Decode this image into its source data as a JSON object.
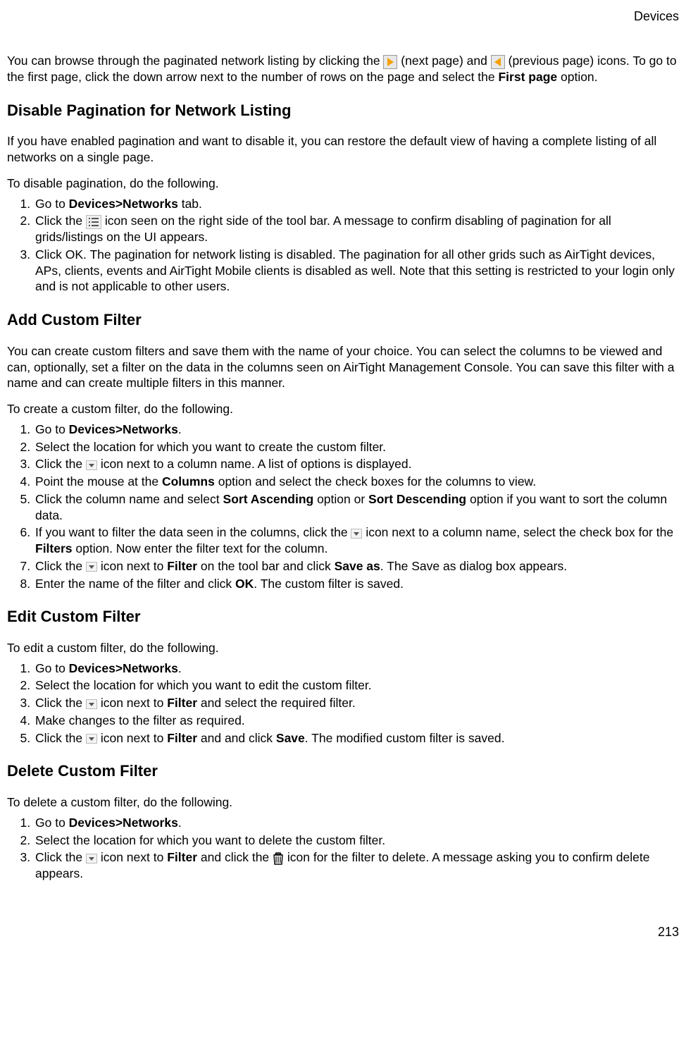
{
  "header": {
    "section": "Devices"
  },
  "footer": {
    "page": "213"
  },
  "intro": {
    "t1": "You can browse through the paginated network listing by clicking the ",
    "t2": " (next page) and ",
    "t3": " (previous page) icons. To go to the first page, click the down arrow next to the number of rows on the page and select the ",
    "t3b": "First page",
    "t4": " option."
  },
  "s1": {
    "heading": "Disable Pagination for Network Listing",
    "p1": "If you have enabled pagination and want to disable it, you can restore the default view of having a complete listing of all networks on a single page.",
    "p2": "To disable pagination, do the following.",
    "li1a": "Go to ",
    "li1b": "Devices>Networks",
    "li1c": " tab.",
    "li2a": "Click the ",
    "li2b": " icon seen on the right side of the tool bar. A message to confirm disabling of pagination for all grids/listings on the UI appears.",
    "li3": "Click OK. The pagination for network listing is disabled. The pagination for all other grids such as AirTight devices, APs, clients, events and AirTight Mobile clients is disabled as well. Note that this setting is restricted to your login only and is not applicable to other users."
  },
  "s2": {
    "heading": "Add Custom Filter",
    "p1": "You can create custom filters and save them with the name of your choice. You can select the columns to be viewed and can, optionally, set a filter on the data in the columns seen on AirTight Management Console. You can save this filter with a name and can create multiple filters in this manner.",
    "p2": "To create a custom filter, do the following.",
    "li1a": "Go to ",
    "li1b": "Devices>Networks",
    "li1c": ".",
    "li2": "Select the location for which you want to create the custom filter.",
    "li3a": "Click the ",
    "li3b": " icon next to a column name. A list of options is displayed.",
    "li4a": "Point the mouse at the ",
    "li4b": "Columns",
    "li4c": " option and select the check boxes for the columns to view.",
    "li5a": "Click the column name and select ",
    "li5b": "Sort Ascending",
    "li5c": " option or ",
    "li5d": "Sort Descending",
    "li5e": " option if you want to sort the column data.",
    "li6a": "If you want to filter the data seen in the columns, click the ",
    "li6b": "  icon next to a column name, select the check box for the ",
    "li6c": "Filters",
    "li6d": " option. Now enter the filter text for the column.",
    "li7a": "Click the ",
    "li7b": " icon next to ",
    "li7c": "Filter",
    "li7d": " on the tool bar and click ",
    "li7e": "Save as",
    "li7f": ". The Save as dialog box appears.",
    "li8a": "Enter the name of the filter and click ",
    "li8b": "OK",
    "li8c": ". The custom filter is saved."
  },
  "s3": {
    "heading": "Edit Custom Filter",
    "p1": "To edit a custom filter, do the following.",
    "li1a": "Go to ",
    "li1b": "Devices>Networks",
    "li1c": ".",
    "li2": "Select the location for which you want to edit the custom filter.",
    "li3a": "Click the ",
    "li3b": " icon next to ",
    "li3c": "Filter",
    "li3d": " and select the required filter.",
    "li4": "Make changes to the filter as required.",
    "li5a": "Click the ",
    "li5b": " icon next to ",
    "li5c": "Filter",
    "li5d": " and and click ",
    "li5e": "Save",
    "li5f": ". The modified custom filter is saved."
  },
  "s4": {
    "heading": "Delete Custom Filter",
    "p1": "To delete a custom filter, do the following.",
    "li1a": "Go to ",
    "li1b": "Devices>Networks",
    "li1c": ".",
    "li2": "Select the location for which you want to delete the custom filter.",
    "li3a": "Click the ",
    "li3b": " icon next to ",
    "li3c": "Filter",
    "li3d": " and click the ",
    "li3e": " icon for the filter to delete. A message asking you to confirm delete appears."
  }
}
